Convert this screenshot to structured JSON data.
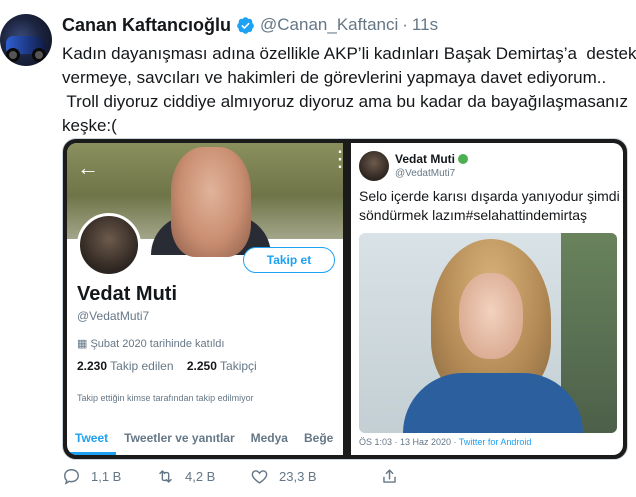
{
  "author": {
    "name": "Canan Kaftancıoğlu",
    "handle": "@Canan_Kaftanci",
    "separator": "·",
    "time": "11s"
  },
  "tweet": {
    "lines": [
      "Kadın dayanışması adına özellikle AKP’li kadınları Başak Demirtaş’a  destek",
      "vermeye, savcıları ve hakimleri de görevlerini yapmaya davet ediyorum..",
      " Troll diyoruz ciddiye almıyoruz diyoruz ama bu kadar da bayağılaşmasanız",
      "keşke:("
    ]
  },
  "media_left": {
    "follow_button": "Takip et",
    "profile_name": "Vedat Muti⁡",
    "profile_handle": "@VedatMuti7",
    "joined": "Şubat 2020 tarihinde katıldı",
    "following_count": "2.230",
    "following_label": "Takip edilen",
    "followers_count": "2.250",
    "followers_label": "Takipçi",
    "note": "Takip ettiğin kimse tarafından takip edilmiyor",
    "tabs": [
      "Tweet",
      "Tweetler ve yanıtlar",
      "Medya",
      "Beğe"
    ]
  },
  "media_right": {
    "name": "Vedat Muti",
    "handle": "@VedatMuti7",
    "text_lines": [
      "Selo içerde karısı dışarda yanıyodur şimdi",
      "söndürmek lazım#selahattindemirtaş"
    ],
    "timestamp": "ÖS 1:03 · 13 Haz 2020 · ",
    "source": "Twitter for Android"
  },
  "actions": {
    "replies": "1,1 B",
    "retweets": "4,2 B",
    "likes": "23,3 B"
  },
  "colors": {
    "accent": "#1da1f2",
    "muted": "#657786",
    "text": "#14171a"
  }
}
